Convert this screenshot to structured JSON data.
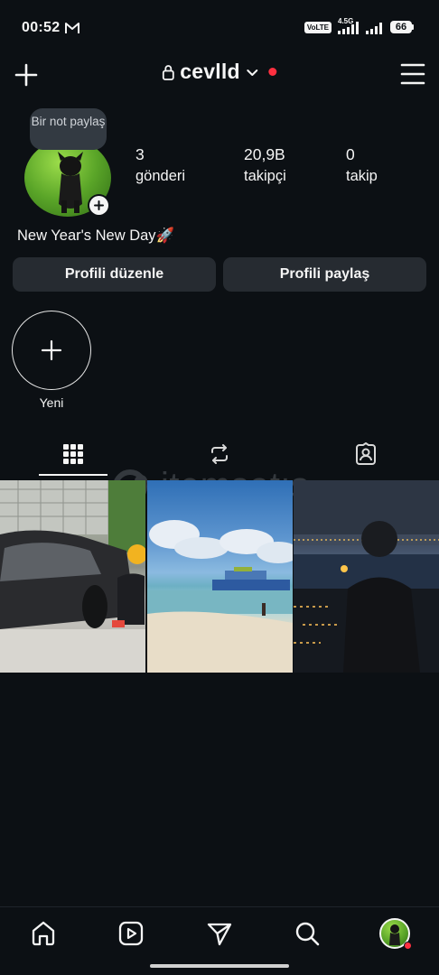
{
  "status_bar": {
    "time": "00:52",
    "volte": "VoLTE",
    "network": "4.5G",
    "battery": "66"
  },
  "header": {
    "username": "cevlld"
  },
  "profile": {
    "note": "Bir not paylaş",
    "bio": "New Year's New Day🚀",
    "stats": {
      "posts_value": "3",
      "posts_label": "gönderi",
      "followers_value": "20,9B",
      "followers_label": "takipçi",
      "following_value": "0",
      "following_label": "takip"
    },
    "buttons": {
      "edit": "Profili düzenle",
      "share": "Profili paylaş"
    }
  },
  "highlights": {
    "new_label": "Yeni"
  },
  "tabs": [
    {
      "icon": "grid-icon",
      "active": true
    },
    {
      "icon": "reposts-icon",
      "active": false
    },
    {
      "icon": "tagged-icon",
      "active": false
    }
  ],
  "watermark": "itemsatış",
  "posts": [
    {
      "subject": "car-photo"
    },
    {
      "subject": "beach-photo"
    },
    {
      "subject": "city-night-photo"
    }
  ],
  "bottom_nav": [
    "home-icon",
    "reels-icon",
    "direct-icon",
    "search-icon",
    "profile-avatar"
  ],
  "colors": {
    "background": "#0c1014",
    "button": "#262b31",
    "notification": "#ff3040"
  }
}
